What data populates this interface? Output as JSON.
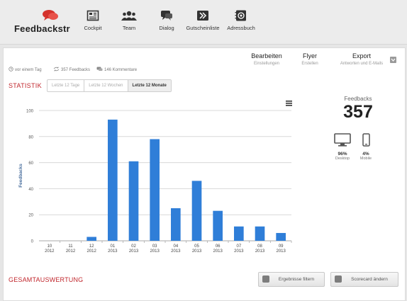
{
  "app": {
    "logo_text": "Feedbackstr"
  },
  "nav": [
    {
      "label": "Cockpit",
      "icon": "cockpit-icon"
    },
    {
      "label": "Team",
      "icon": "team-icon"
    },
    {
      "label": "Dialog",
      "icon": "dialog-icon"
    },
    {
      "label": "Gutscheinliste",
      "icon": "voucher-list-icon"
    },
    {
      "label": "Adressbuch",
      "icon": "address-book-icon"
    }
  ],
  "header_links": [
    {
      "title": "Bearbeiten",
      "subtitle": "Einstellungen"
    },
    {
      "title": "Flyer",
      "subtitle": "Erstellen"
    },
    {
      "title": "Export",
      "subtitle": "Antworten und E-Mails"
    }
  ],
  "meta": {
    "time": "vor einem Tag",
    "feedbacks": "357 Feedbacks",
    "comments": "146 Kommentare"
  },
  "statistik": {
    "title": "STATISTIK",
    "tabs": [
      "Letzte 12 Tage",
      "Letzte 12 Wochen",
      "Letzte 12 Monate"
    ],
    "active_tab": 2
  },
  "summary": {
    "label": "Feedbacks",
    "count": "357",
    "devices": [
      {
        "name": "Desktop",
        "percent": "96%",
        "icon": "desktop-icon"
      },
      {
        "name": "Mobile",
        "percent": "4%",
        "icon": "mobile-icon"
      }
    ]
  },
  "chart_data": {
    "type": "bar",
    "ylabel": "Feedbacks",
    "ylim": [
      0,
      100
    ],
    "yticks": [
      0,
      20,
      40,
      60,
      80,
      100
    ],
    "grid": true,
    "color": "#2f7ed8",
    "categories": [
      [
        "10",
        "2012"
      ],
      [
        "11",
        "2012"
      ],
      [
        "12",
        "2012"
      ],
      [
        "01",
        "2013"
      ],
      [
        "02",
        "2013"
      ],
      [
        "03",
        "2013"
      ],
      [
        "04",
        "2013"
      ],
      [
        "05",
        "2013"
      ],
      [
        "06",
        "2013"
      ],
      [
        "07",
        "2013"
      ],
      [
        "08",
        "2013"
      ],
      [
        "09",
        "2013"
      ]
    ],
    "values": [
      0,
      0,
      3,
      93,
      61,
      78,
      25,
      46,
      23,
      11,
      11,
      6
    ]
  },
  "gesamt": {
    "title": "GESAMTAUSWERTUNG",
    "filter_button": "Ergebnisse filtern",
    "scorecard_button": "Scorecard ändern"
  }
}
